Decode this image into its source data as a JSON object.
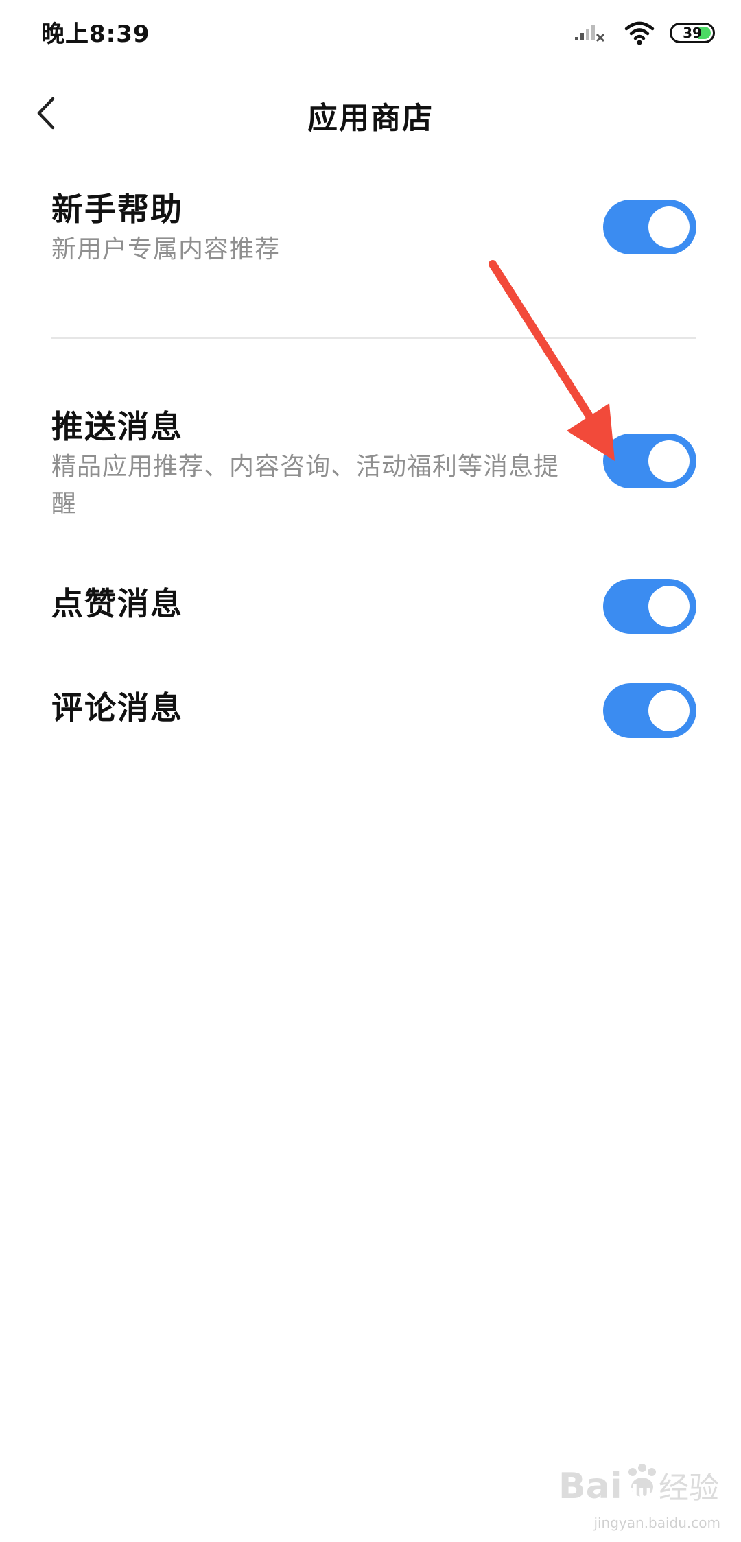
{
  "status_bar": {
    "time": "晚上8:39",
    "battery_level": "39",
    "icons": [
      "signal-icon",
      "wifi-icon",
      "battery-icon"
    ]
  },
  "header": {
    "back_icon": "chevron-left-icon",
    "title": "应用商店"
  },
  "settings": [
    {
      "title": "新手帮助",
      "description": "新用户专属内容推荐",
      "enabled": true
    },
    {
      "title": "推送消息",
      "description": "精品应用推荐、内容咨询、活动福利等消息提醒",
      "enabled": true
    },
    {
      "title": "点赞消息",
      "description": "",
      "enabled": true
    },
    {
      "title": "评论消息",
      "description": "",
      "enabled": true
    }
  ],
  "colors": {
    "toggle_on": "#3b8cf1",
    "annotation_arrow": "#f24a3a",
    "description_text": "#8f8f8f",
    "battery_fill": "#4cd964"
  },
  "watermark": {
    "logo_text": "Baidu经验",
    "url": "jingyan.baidu.com"
  }
}
